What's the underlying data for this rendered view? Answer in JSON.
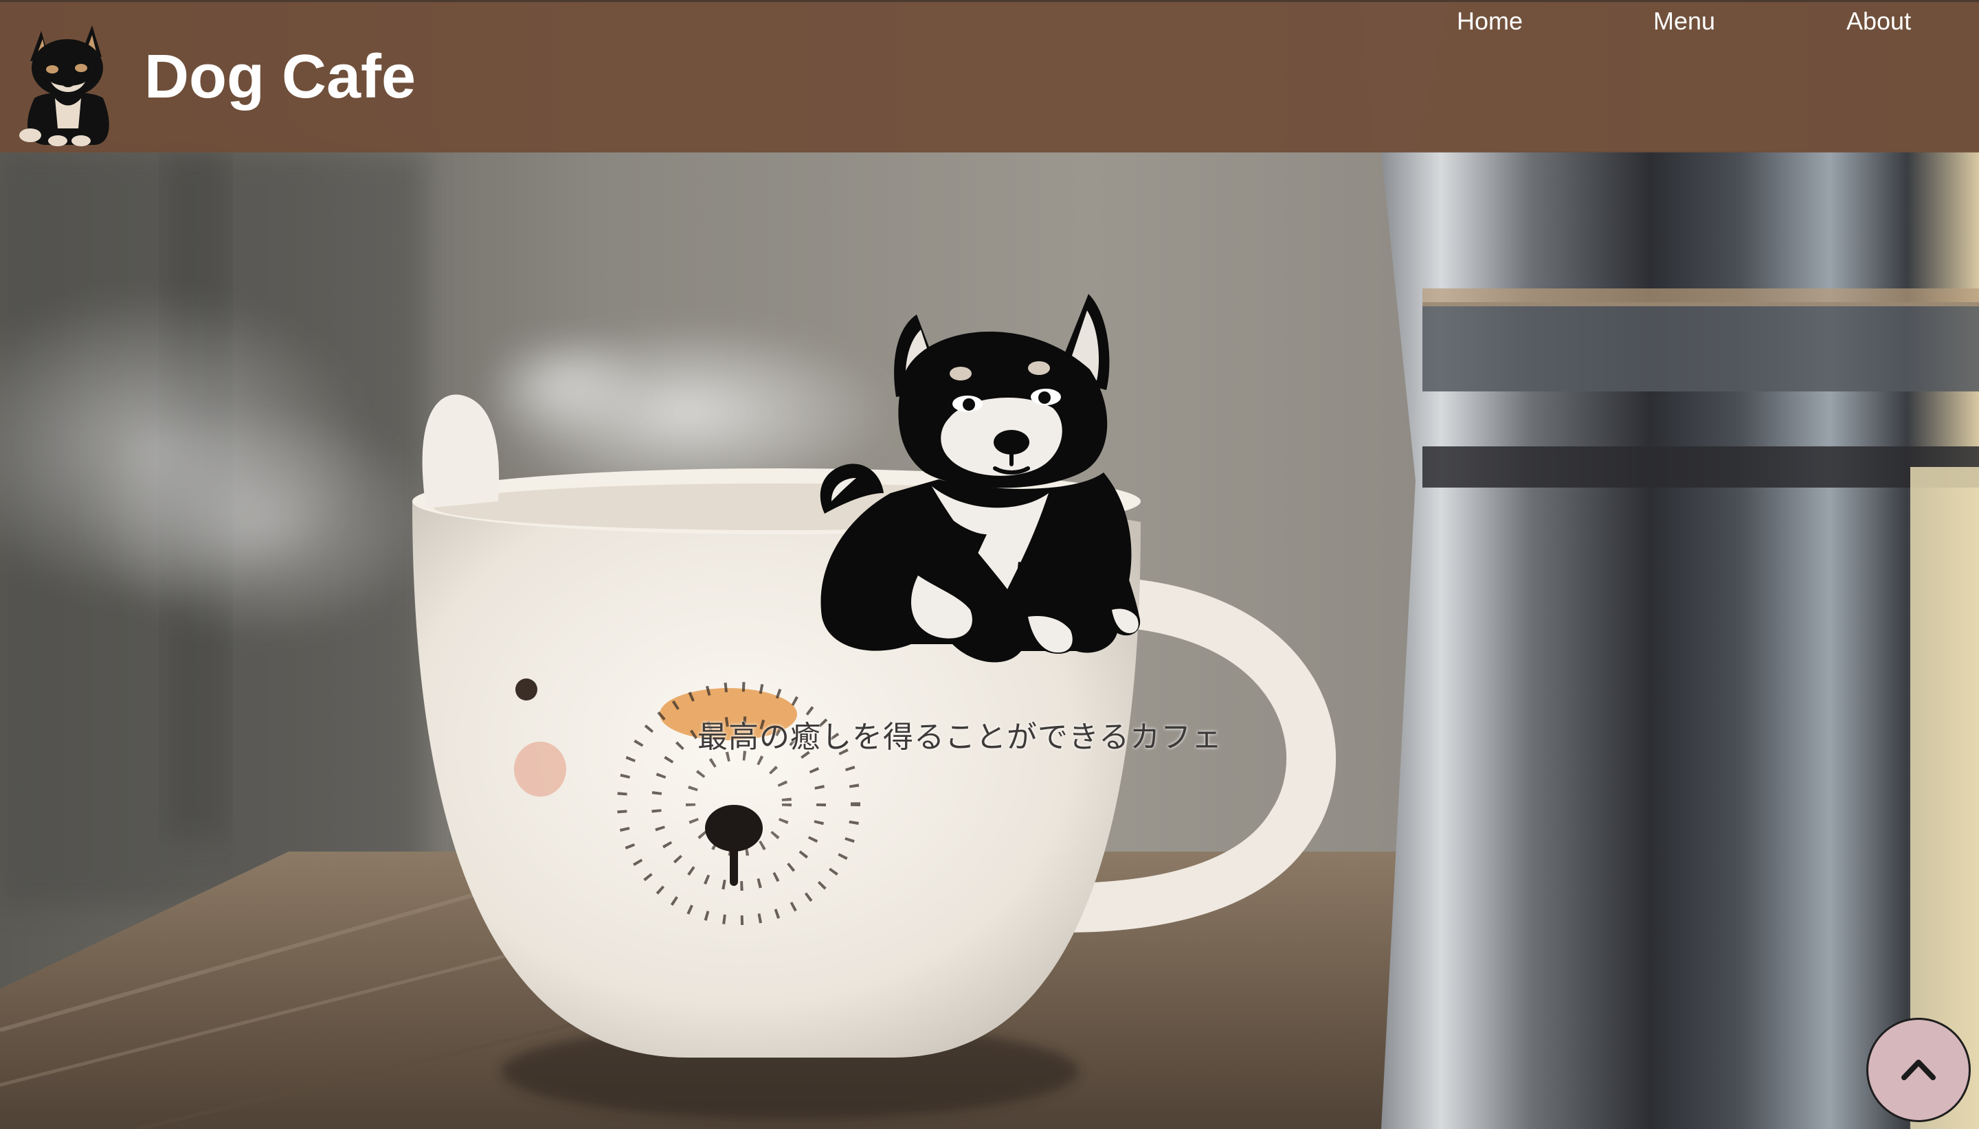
{
  "header": {
    "brand": "Dog Cafe",
    "logo_icon": "shiba-dog-logo-icon",
    "background_color": "#704e38"
  },
  "nav": {
    "items": [
      {
        "label": "Home"
      },
      {
        "label": "Menu"
      },
      {
        "label": "About"
      }
    ]
  },
  "hero": {
    "illustration_icon": "shiba-dog-illustration",
    "tagline": "最高の癒しを得ることができるカフェ"
  },
  "scroll_top": {
    "icon": "chevron-up-icon",
    "color": "#d6b7bc"
  }
}
